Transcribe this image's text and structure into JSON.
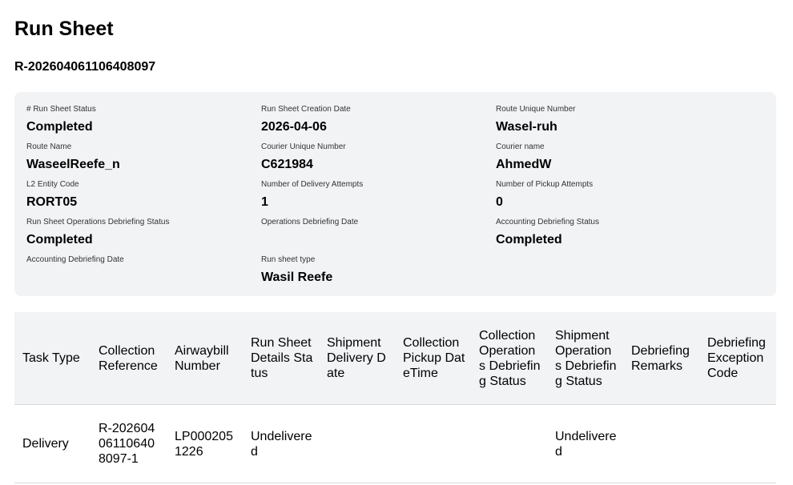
{
  "page": {
    "title": "Run Sheet",
    "sheet_id": "R-202604061106408097"
  },
  "details": {
    "run_sheet_status": {
      "label": "# Run Sheet Status",
      "value": "Completed"
    },
    "creation_date": {
      "label": "Run Sheet Creation Date",
      "value": "2026-04-06"
    },
    "route_unique_number": {
      "label": "Route Unique Number",
      "value": "Wasel-ruh"
    },
    "route_name": {
      "label": "Route Name",
      "value": "WaseelReefe_n"
    },
    "courier_unique_number": {
      "label": "Courier Unique Number",
      "value": "C621984"
    },
    "courier_name": {
      "label": "Courier name",
      "value": "AhmedW"
    },
    "l2_entity_code": {
      "label": "L2 Entity Code",
      "value": "RORT05"
    },
    "delivery_attempts": {
      "label": "Number of Delivery Attempts",
      "value": "1"
    },
    "pickup_attempts": {
      "label": "Number of Pickup Attempts",
      "value": "0"
    },
    "ops_debriefing_status": {
      "label": "Run Sheet Operations Debriefing Status",
      "value": "Completed"
    },
    "ops_debriefing_date": {
      "label": "Operations Debriefing Date",
      "value": ""
    },
    "accounting_debriefing_status": {
      "label": "Accounting Debriefing Status",
      "value": "Completed"
    },
    "accounting_debriefing_date": {
      "label": "Accounting Debriefing Date",
      "value": ""
    },
    "run_sheet_type": {
      "label": "Run sheet type",
      "value": "Wasil Reefe"
    }
  },
  "table": {
    "headers": [
      "Task Type",
      "Collection Reference",
      "Airwaybill Number",
      "Run Sheet Details Status",
      "Shipment Delivery Date",
      "Collection Pickup DateTime",
      "Collection Operations Debriefing Status",
      "Shipment Operations Debriefing Status",
      "Debriefing Remarks",
      "Debriefing Exception Code"
    ],
    "rows": [
      [
        "Delivery",
        "R-202604061106408097-1",
        "LP0002051226",
        "Undelivered",
        "",
        "",
        "",
        "Undelivered",
        "",
        ""
      ]
    ]
  }
}
